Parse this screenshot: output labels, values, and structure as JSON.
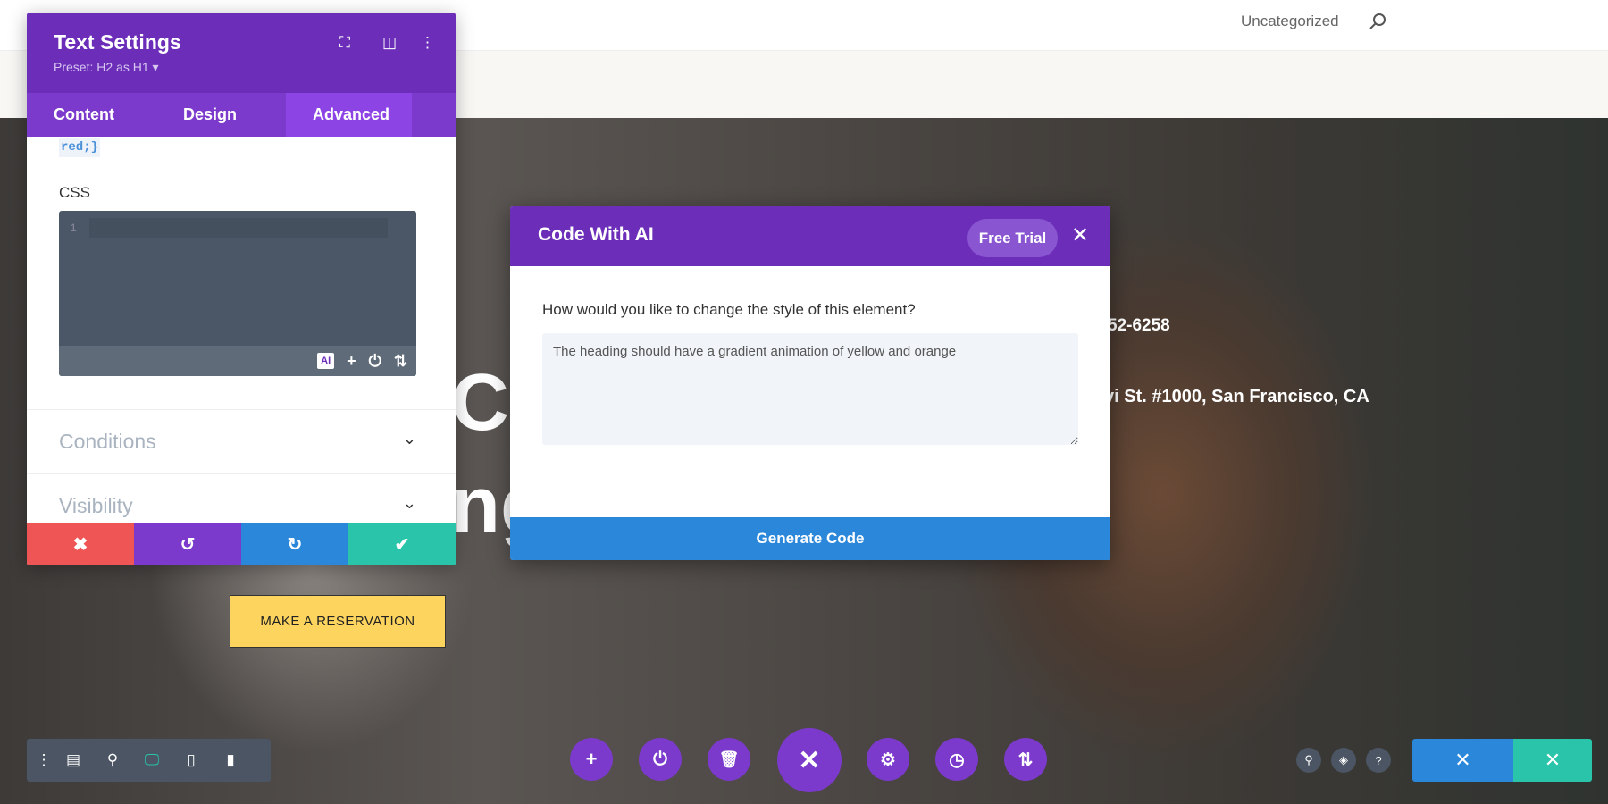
{
  "site": {
    "nav_category": "Uncategorized",
    "phone_partial": "52-6258",
    "address_partial": "vi St. #1000, San Francisco, CA",
    "heading_partial_1": "Cu",
    "heading_partial_2": "ng",
    "reservation_button": "MAKE A RESERVATION"
  },
  "panel": {
    "title": "Text Settings",
    "preset": "Preset: H2 as H1",
    "tabs": [
      {
        "label": "Content"
      },
      {
        "label": "Design"
      },
      {
        "label": "Advanced",
        "active": true
      }
    ],
    "code_snippet": "red;}",
    "css_label": "CSS",
    "line_number": "1",
    "ai_badge": "AI",
    "sections": [
      {
        "label": "Conditions"
      },
      {
        "label": "Visibility"
      }
    ]
  },
  "modal": {
    "title": "Code With AI",
    "free_trial": "Free Trial",
    "question": "How would you like to change the style of this element?",
    "prompt_value": "The heading should have a gradient animation of yellow and orange",
    "generate_button": "Generate Code"
  },
  "colors": {
    "purple": "#6c2eb9",
    "tab_active": "#8d44e4",
    "blue": "#2b87da",
    "green": "#29c4a9",
    "red": "#ef5555",
    "yellow": "#fdd55e"
  }
}
